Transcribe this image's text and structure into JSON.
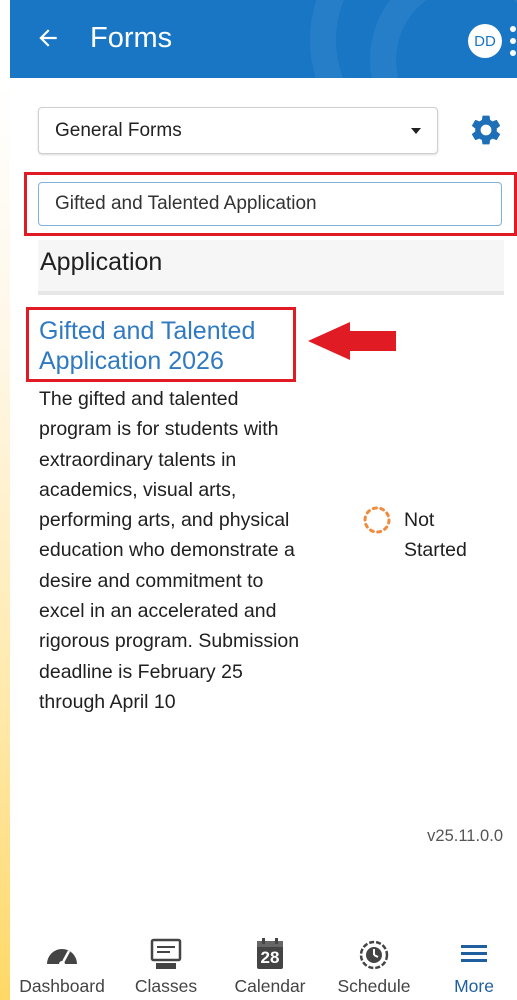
{
  "header": {
    "title": "Forms",
    "avatar_initials": "DD",
    "back_icon": "arrow-left-icon",
    "menu_icon": "kebab-menu-icon",
    "background_color": "#1976c5"
  },
  "filters": {
    "category_select": {
      "selected": "General Forms"
    },
    "settings_icon": "gear-icon",
    "search": {
      "value": "Gifted and Talented Application"
    }
  },
  "section": {
    "title": "Application"
  },
  "form": {
    "title": "Gifted and Talented Application 2026",
    "description": "The gifted and talented program is for students with extraordinary talents in academics, visual arts, performing arts, and physical education who demonstrate a desire and commitment to excel in an accelerated and rigorous program. Submission deadline is February 25 through April 10",
    "status": "Not Started",
    "status_color": "#f08a3c",
    "link_color": "#2f7ac0"
  },
  "annotations": {
    "highlight_color": "#e01b24"
  },
  "version": "v25.11.0.0",
  "bottom_nav": {
    "items": [
      {
        "label": "Dashboard",
        "icon": "speedometer-icon"
      },
      {
        "label": "Classes",
        "icon": "classroom-board-icon"
      },
      {
        "label": "Calendar",
        "icon": "calendar-icon",
        "day": "28"
      },
      {
        "label": "Schedule",
        "icon": "clock-icon"
      },
      {
        "label": "More",
        "icon": "hamburger-menu-icon",
        "active": true
      }
    ],
    "active_color": "#1f5f9f"
  }
}
